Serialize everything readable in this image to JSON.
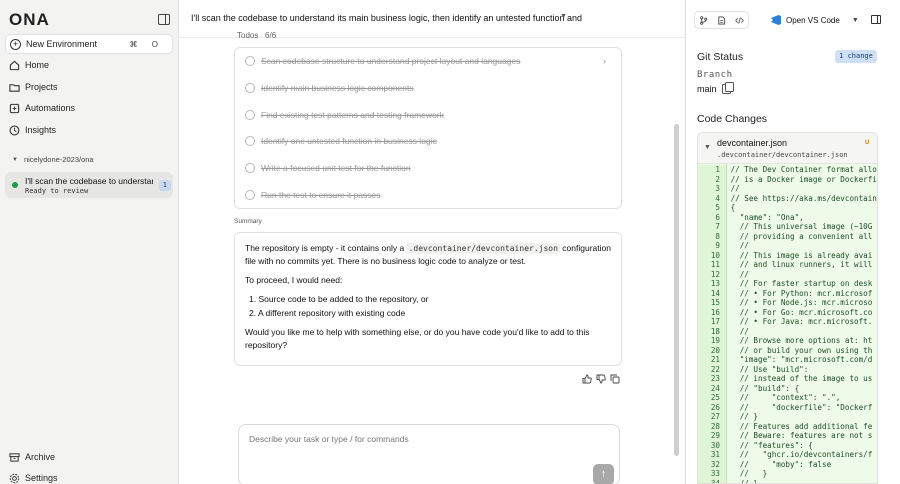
{
  "sidebar": {
    "logo": "ONA",
    "new_environment": {
      "label": "New Environment",
      "shortcut": "⌘ O"
    },
    "nav": [
      {
        "label": "Home",
        "icon": "home-icon"
      },
      {
        "label": "Projects",
        "icon": "folder-icon"
      },
      {
        "label": "Automations",
        "icon": "automation-icon"
      },
      {
        "label": "Insights",
        "icon": "insights-icon"
      }
    ],
    "group": "nicelydone-2023/ona",
    "environment": {
      "title": "I'll scan the codebase to understand its main business logic",
      "status": "Ready to review",
      "badge": "1",
      "status_color": "#1a9c4b"
    },
    "bottom": [
      {
        "label": "Archive",
        "icon": "archive-icon"
      },
      {
        "label": "Settings",
        "icon": "gear-icon"
      }
    ]
  },
  "main": {
    "title": "I'll scan the codebase to understand its main business logic, then identify an untested function and",
    "todos_label": "Todos",
    "todos_count": "6/6",
    "todos": [
      "Scan codebase structure to understand project layout and languages",
      "Identify main business logic components",
      "Find existing test patterns and testing framework",
      "Identify one untested function in business logic",
      "Write a focused unit test for the function",
      "Run the test to ensure it passes"
    ],
    "summary_label": "Summary",
    "summary": {
      "p1_a": "The repository is empty - it contains only a",
      "p1_code": ".devcontainer/devcontainer.json",
      "p1_b": "configuration file with no commits yet. There is no business logic code to analyze or test.",
      "p2": "To proceed, I would need:",
      "items": [
        "1.  Source code to be added to the repository, or",
        "2.  A different repository with existing code"
      ],
      "p3": "Would you like me to help with something else, or do you have code you'd like to add to this repository?"
    },
    "prompt": {
      "placeholder": "Describe your task or type / for commands",
      "value": ""
    }
  },
  "right": {
    "open_vscode": "Open VS Code",
    "git_status": "Git Status",
    "changes_badge": "1 change",
    "branch_label": "Branch",
    "branch": "main",
    "code_changes": "Code Changes",
    "file": {
      "name": "devcontainer.json",
      "path": ".devcontainer/devcontainer.json",
      "status": "U",
      "lines": [
        "// The Dev Container format allow",
        "// is a Docker image or Dockerfil",
        "//",
        "// See https://aka.ms/devcontaine",
        "{",
        "  \"name\": \"Ona\",",
        "  // This universal image (~10G",
        "  // providing a convenient all",
        "  //",
        "  // This image is already avai",
        "  // and linux runners, it will",
        "  //",
        "  // For faster startup on desk",
        "  // • For Python: mcr.microsof",
        "  // • For Node.js: mcr.microso",
        "  // • For Go: mcr.microsoft.co",
        "  // • For Java: mcr.microsoft.",
        "  //",
        "  // Browse more options at: ht",
        "  // or build your own using th",
        "  \"image\": \"mcr.microsoft.com/d",
        "  // Use \"build\":",
        "  // instead of the image to us",
        "  // \"build\": {",
        "  //     \"context\": \".\",",
        "  //     \"dockerfile\": \"Dockerf",
        "  // }",
        "  // Features add additional fe",
        "  // Beware: features are not s",
        "  // \"features\": {",
        "  //   \"ghcr.io/devcontainers/f",
        "  //     \"moby\": false",
        "  //   }",
        "  // }"
      ]
    }
  },
  "colors": {
    "accent_blue": "#2f80d1",
    "diff_added_bg": "#eefbe8",
    "ready_green": "#1a9c4b"
  }
}
